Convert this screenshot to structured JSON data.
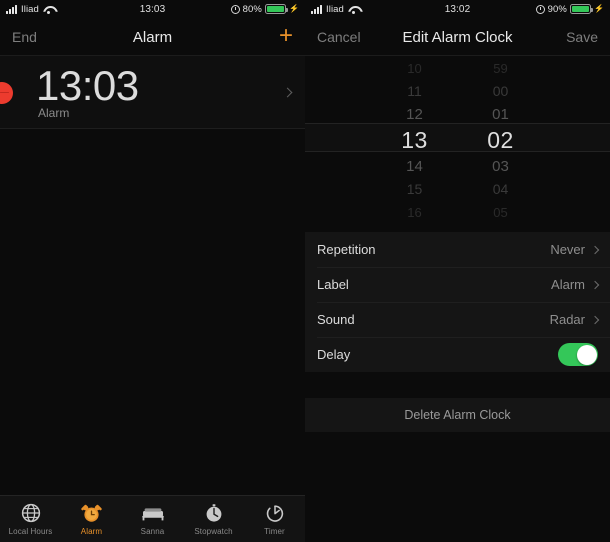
{
  "left": {
    "status": {
      "carrier": "Iliad",
      "time": "13:03",
      "battery_pct": "80%",
      "signal_icon": "signal-bars-icon",
      "wifi_icon": "wifi-icon",
      "alarm_icon": "alarm-clock-icon",
      "battery_icon": "battery-icon",
      "charging_icon": "bolt-icon"
    },
    "nav": {
      "left_button": "End",
      "title": "Alarm",
      "add_button": "+"
    },
    "alarm": {
      "time": "13:03",
      "label": "Alarm",
      "delete_icon": "minus-circle-icon",
      "disclosure_icon": "chevron-right-icon"
    },
    "tabs": [
      {
        "label": "Local Hours",
        "icon": "globe-icon",
        "active": false
      },
      {
        "label": "Alarm",
        "icon": "alarm-clock-icon",
        "active": true
      },
      {
        "label": "Sanna",
        "icon": "bed-icon",
        "active": false
      },
      {
        "label": "Stopwatch",
        "icon": "stopwatch-icon",
        "active": false
      },
      {
        "label": "Timer",
        "icon": "timer-icon",
        "active": false
      }
    ]
  },
  "right": {
    "status": {
      "carrier": "Iliad",
      "time": "13:02",
      "battery_pct": "90%"
    },
    "nav": {
      "cancel": "Cancel",
      "title": "Edit Alarm Clock",
      "save": "Save"
    },
    "picker": {
      "selected_hour": "13",
      "selected_minute": "02",
      "hours": [
        "10",
        "11",
        "12",
        "13",
        "14",
        "15",
        "16"
      ],
      "minutes": [
        "59",
        "00",
        "01",
        "02",
        "03",
        "04",
        "05"
      ]
    },
    "settings": [
      {
        "key": "Repetition",
        "value": "Never",
        "type": "disclosure"
      },
      {
        "key": "Label",
        "value": "Alarm",
        "type": "disclosure"
      },
      {
        "key": "Sound",
        "value": "Radar",
        "type": "disclosure"
      },
      {
        "key": "Delay",
        "value": "on",
        "type": "toggle"
      }
    ],
    "delete_button": "Delete Alarm Clock"
  },
  "colors": {
    "accent": "#e8912a",
    "toggle_on": "#34c759",
    "delete_red": "#ec3b2e",
    "background": "#0b0b0b"
  }
}
